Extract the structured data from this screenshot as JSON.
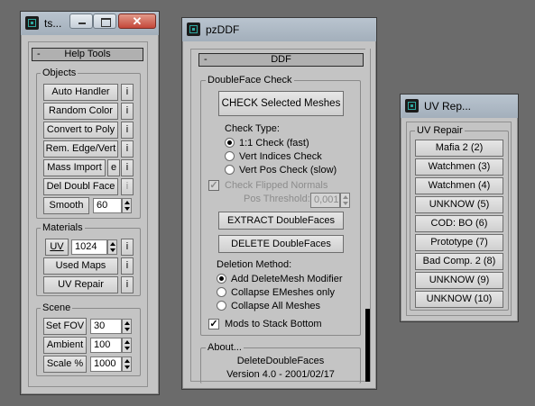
{
  "window1": {
    "title": "ts...",
    "rollout": "Help Tools",
    "objects": {
      "label": "Objects",
      "auto_handler": "Auto Handler",
      "random_color": "Random Color",
      "convert_to_poly": "Convert to Poly",
      "rem_edge_vert": "Rem. Edge/Vert",
      "mass_import": "Mass Import",
      "mass_import_e": "e",
      "del_doubl_face": "Del Doubl Face",
      "smooth": "Smooth",
      "smooth_value": "60",
      "info": "i"
    },
    "materials": {
      "label": "Materials",
      "uv_label": "UV",
      "uv_value": "1024",
      "used_maps": "Used Maps",
      "uv_repair": "UV Repair"
    },
    "scene": {
      "label": "Scene",
      "set_fov": "Set FOV",
      "fov_value": "30",
      "ambient": "Ambient",
      "ambient_value": "100",
      "scale": "Scale %",
      "scale_value": "1000"
    }
  },
  "window2": {
    "title": "pzDDF",
    "rollout": "DDF",
    "group_label": "DoubleFace Check",
    "check_selected": "CHECK Selected Meshes",
    "check_type_label": "Check Type:",
    "radio_1_1": "1:1 Check (fast)",
    "radio_vert_indices": "Vert Indices Check",
    "radio_vert_pos": "Vert Pos Check (slow)",
    "check_flipped": "Check Flipped Normals",
    "pos_threshold_label": "Pos Threshold:",
    "pos_threshold_value": "0,001",
    "extract": "EXTRACT DoubleFaces",
    "delete": "DELETE DoubleFaces",
    "deletion_method_label": "Deletion Method:",
    "radio_add_modifier": "Add DeleteMesh Modifier",
    "radio_collapse_emeshes": "Collapse EMeshes only",
    "radio_collapse_all": "Collapse All Meshes",
    "mods_to_stack": "Mods to Stack Bottom",
    "check_mark": "✓",
    "about_label": "About...",
    "about_name": "DeleteDoubleFaces",
    "about_version": "Version 4.0 - 2001/02/17"
  },
  "window3": {
    "title": "UV Rep...",
    "group_label": "UV Repair",
    "buttons": [
      "Mafia 2 (2)",
      "Watchmen (3)",
      "Watchmen (4)",
      "UNKNOW (5)",
      "COD: BO (6)",
      "Prototype (7)",
      "Bad Comp. 2 (8)",
      "UNKNOW (9)",
      "UNKNOW (10)"
    ]
  },
  "titlebar": {
    "close_glyph": "✕"
  },
  "colors": {
    "window_bg": "#c4c4c4",
    "desktop": "#6b6b6b",
    "title_bar": "#a9b5c1",
    "close": "#c4473a"
  }
}
